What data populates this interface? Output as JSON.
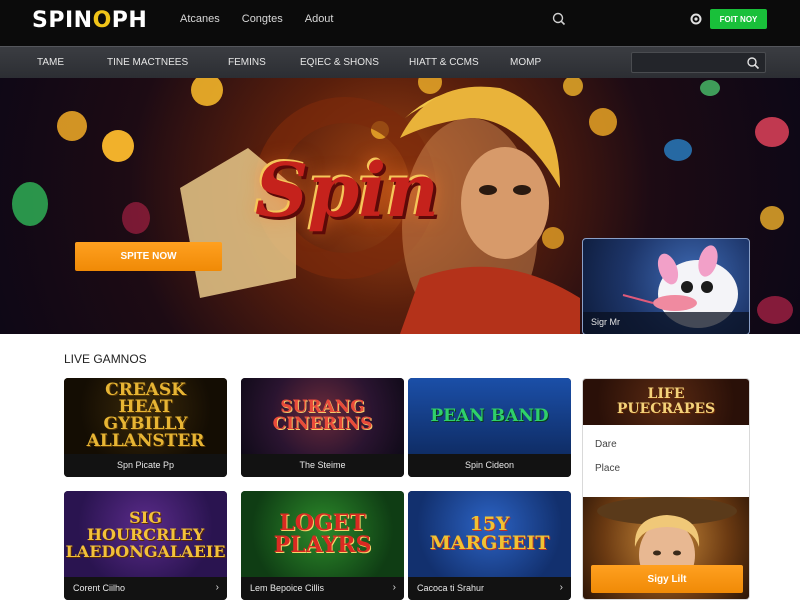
{
  "brand": {
    "logo_left": "SPIN",
    "logo_mark": "O",
    "logo_right": "PH"
  },
  "topnav": [
    "Atcanes",
    "Congtes",
    "Adout"
  ],
  "header": {
    "signup_label": "FOIT NOY"
  },
  "categories": [
    "TAME",
    "TINE MACTNEES",
    "FEMINS",
    "EQIEC & SHONS",
    "HIATT & CCMS",
    "MOMP"
  ],
  "search": {
    "placeholder": "",
    "value": ""
  },
  "hero": {
    "title": "Spin",
    "cta_label": "SPITE NOW",
    "promo_label": "Sigr Mr"
  },
  "live_games": {
    "title": "LIVE GAMNOS",
    "cards": [
      {
        "art": "CREASK\nHEAT\nGYBILLY\nALLANSTER",
        "label": "Spn Picate Pp"
      },
      {
        "art": "SURANG\nCINERINS",
        "label": "The Steime"
      },
      {
        "art": "PEAN BAND",
        "label": "Spin Cideon"
      },
      {
        "art": "SIG\nHOURCRLEY\nLAEDONGALAEIE",
        "label": "Corent Ciilho"
      },
      {
        "art": "LOGET\nPLAYRS",
        "label": "Lem Bepoice Cillis"
      },
      {
        "art": "15Y\nMARGEEIT",
        "label": "Cacoca ti Srahur"
      }
    ]
  },
  "side_panel": {
    "title": "LIFE\nPUECRAPES",
    "items": [
      "Dare",
      "Place"
    ],
    "button_label": "Sigy Lilt"
  },
  "colors": {
    "signup_green": "#19c03a",
    "cta_orange": "#f59a10",
    "topbar": "#0b0b0b",
    "catbar": "#34363b"
  }
}
